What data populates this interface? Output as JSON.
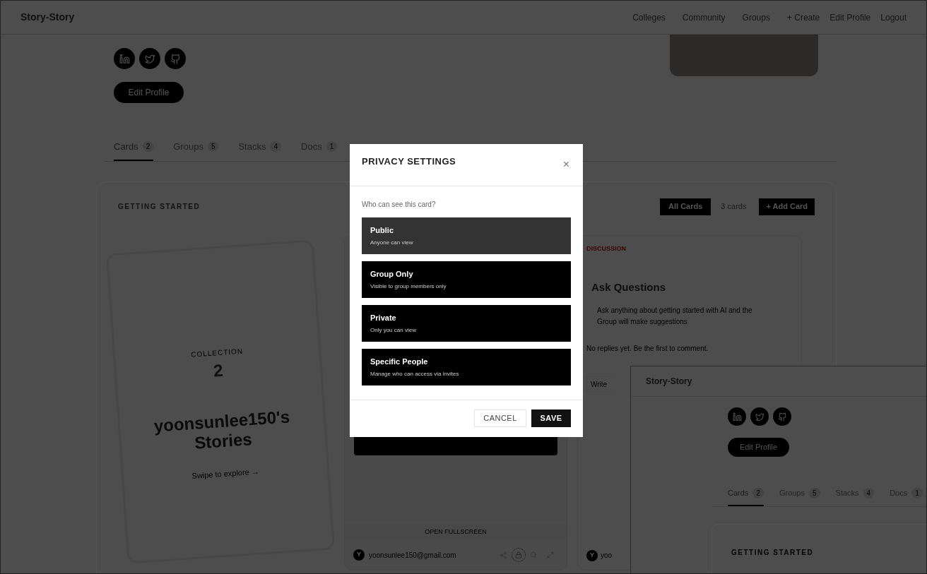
{
  "navbar": {
    "brand": "Story-Story",
    "links": [
      "Colleges",
      "Community",
      "Groups",
      "+ Create",
      "Edit Profile",
      "Logout"
    ]
  },
  "profile": {
    "edit_button": "Edit Profile"
  },
  "tabs": [
    {
      "label": "Cards",
      "count": "2",
      "selected": true
    },
    {
      "label": "Groups",
      "count": "5",
      "selected": false
    },
    {
      "label": "Stacks",
      "count": "4",
      "selected": false
    },
    {
      "label": "Docs",
      "count": "1",
      "selected": false
    }
  ],
  "panel": {
    "title": "GETTING STARTED",
    "all_cards_button": "All Cards",
    "card_count": "3 cards",
    "add_button": "+ Add Card",
    "collection_card": {
      "eyebrow": "COLLECTION",
      "number": "2",
      "title": "yoonsunlee150's Stories",
      "hint": "Swipe to explore →"
    },
    "middle_card": {
      "fullscreen_label": "OPEN FULLSCREEN",
      "avatar": "Y",
      "email": "yoonsunlee150@gmail.com"
    },
    "discussion_card": {
      "tag": "DISCUSSION",
      "title": "Ask Questions",
      "body": "Ask anything about getting started with AI and the Group will make suggestions",
      "empty_note": "No replies yet. Be the first to comment.",
      "comment_placeholder": "Write",
      "avatar": "Y",
      "email": "yoo"
    }
  },
  "inset_window": {
    "brand": "Story-Story",
    "edit_button": "Edit Profile",
    "tabs": [
      {
        "label": "Cards",
        "count": "2",
        "selected": true
      },
      {
        "label": "Groups",
        "count": "5",
        "selected": false
      },
      {
        "label": "Stacks",
        "count": "4",
        "selected": false
      },
      {
        "label": "Docs",
        "count": "1",
        "selected": false
      }
    ],
    "panel_title": "GETTING STARTED"
  },
  "modal": {
    "title": "PRIVACY SETTINGS",
    "close": "×",
    "question": "Who can see this card?",
    "options": [
      {
        "label": "Public",
        "description": "Anyone can view",
        "selected": true
      },
      {
        "label": "Group Only",
        "description": "Visible to group members only",
        "selected": false
      },
      {
        "label": "Private",
        "description": "Only you can view",
        "selected": false
      },
      {
        "label": "Specific People",
        "description": "Manage who can access via invites",
        "selected": false
      }
    ],
    "cancel": "CANCEL",
    "save": "SAVE"
  }
}
